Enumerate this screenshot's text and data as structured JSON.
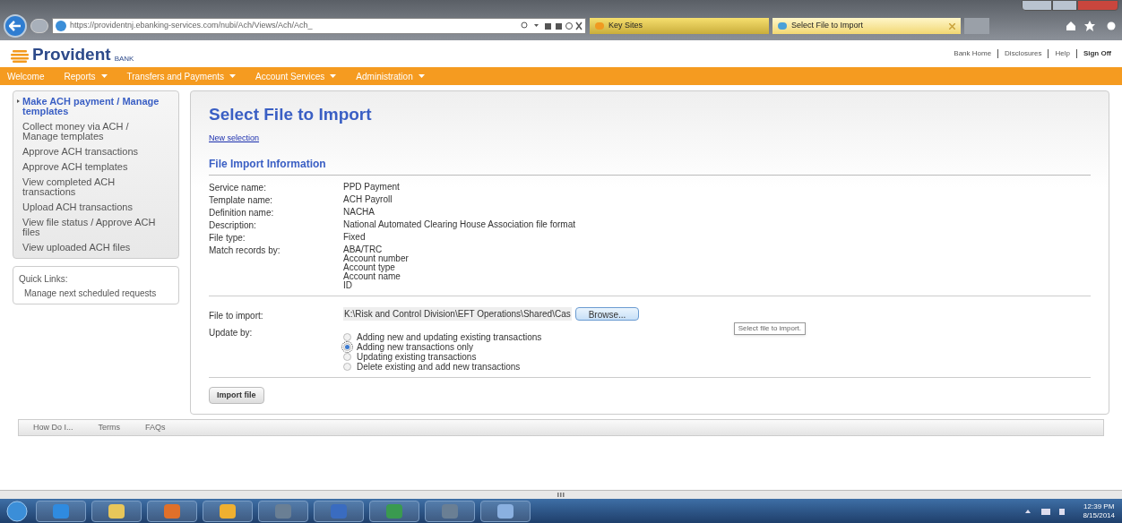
{
  "browser": {
    "url": "https://providentnj.ebanking-services.com/nubi/Ach/Views/Ach/Ach_",
    "tabs": [
      {
        "label": "Key Sites",
        "selected": false
      },
      {
        "label": "Select File to Import",
        "selected": true
      }
    ]
  },
  "header": {
    "logo": "Provident",
    "logo_suffix": "BANK",
    "links": [
      "Bank Home",
      "Disclosures",
      "Help",
      "Sign Off"
    ]
  },
  "nav": [
    {
      "label": "Welcome",
      "has_menu": false
    },
    {
      "label": "Reports",
      "has_menu": true
    },
    {
      "label": "Transfers and Payments",
      "has_menu": true
    },
    {
      "label": "Account Services",
      "has_menu": true
    },
    {
      "label": "Administration",
      "has_menu": true
    }
  ],
  "sidebar": {
    "items": [
      {
        "label": "Make ACH payment / Manage templates",
        "selected": true
      },
      {
        "label": "Collect money via ACH / Manage templates",
        "selected": false
      },
      {
        "label": "Approve ACH transactions",
        "selected": false
      },
      {
        "label": "Approve ACH templates",
        "selected": false
      },
      {
        "label": "View completed ACH transactions",
        "selected": false
      },
      {
        "label": "Upload ACH transactions",
        "selected": false
      },
      {
        "label": "View file status / Approve ACH files",
        "selected": false
      },
      {
        "label": "View uploaded ACH files",
        "selected": false
      }
    ],
    "quick_links": {
      "title": "Quick Links:",
      "items": [
        "Manage next scheduled requests"
      ]
    }
  },
  "main": {
    "title": "Select File to Import",
    "link": "New selection",
    "section_title": "File Import Information",
    "fields": [
      {
        "label": "Service name:",
        "values": [
          "PPD Payment"
        ]
      },
      {
        "label": "Template name:",
        "values": [
          "ACH Payroll"
        ]
      },
      {
        "label": "Definition name:",
        "values": [
          "NACHA"
        ]
      },
      {
        "label": "Description:",
        "values": [
          "National Automated Clearing House Association file format"
        ]
      },
      {
        "label": "File type:",
        "values": [
          "Fixed"
        ]
      },
      {
        "label": "Match records by:",
        "values": [
          "ABA/TRC",
          "Account number",
          "Account type",
          "Account name",
          "ID"
        ]
      }
    ],
    "file_import": {
      "label": "File to import:",
      "value": "K:\\Risk and Control Division\\EFT Operations\\Shared\\Cas",
      "button": "Browse...",
      "tooltip": "Select file to import."
    },
    "update_by": {
      "label": "Update by:",
      "options": [
        {
          "label": "Adding new and updating existing transactions",
          "selected": false
        },
        {
          "label": "Adding new transactions only",
          "selected": true
        },
        {
          "label": "Updating existing transactions",
          "selected": false
        },
        {
          "label": "Delete existing and add new transactions",
          "selected": false
        }
      ]
    },
    "button": "Import file"
  },
  "footer": [
    "How Do I...",
    "Terms",
    "FAQs"
  ],
  "taskbar": {
    "apps": [
      {
        "kind": "browser"
      },
      {
        "kind": "folder"
      },
      {
        "kind": "media"
      },
      {
        "kind": "mail"
      },
      {
        "kind": "window"
      },
      {
        "kind": "word"
      },
      {
        "kind": "excel"
      },
      {
        "kind": "window"
      },
      {
        "kind": "paint"
      }
    ],
    "clock": {
      "time": "12:39 PM",
      "date": "8/15/2014"
    }
  }
}
